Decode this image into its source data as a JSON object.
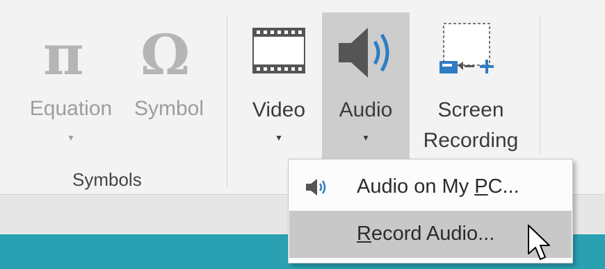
{
  "ribbon": {
    "equation": {
      "label": "Equation",
      "glyph": "π",
      "caret": "▾"
    },
    "symbol": {
      "label": "Symbol",
      "glyph": "Ω"
    },
    "symbols_group_label": "Symbols",
    "video": {
      "label": "Video",
      "caret": "▾"
    },
    "audio": {
      "label": "Audio",
      "caret": "▾"
    },
    "screen_recording": {
      "line1": "Screen",
      "line2": "Recording"
    }
  },
  "audio_menu": {
    "items": [
      {
        "pre": "Audio on My ",
        "accel": "P",
        "post": "C...",
        "icon": "speaker-icon"
      },
      {
        "pre": "",
        "accel": "R",
        "post": "ecord Audio..."
      }
    ]
  },
  "colors": {
    "accent_blue": "#2f7cc4",
    "teal_bar": "#2aa1b3",
    "pressed_bg": "#cdcdcd",
    "hover_bg": "#c8c8c8"
  }
}
